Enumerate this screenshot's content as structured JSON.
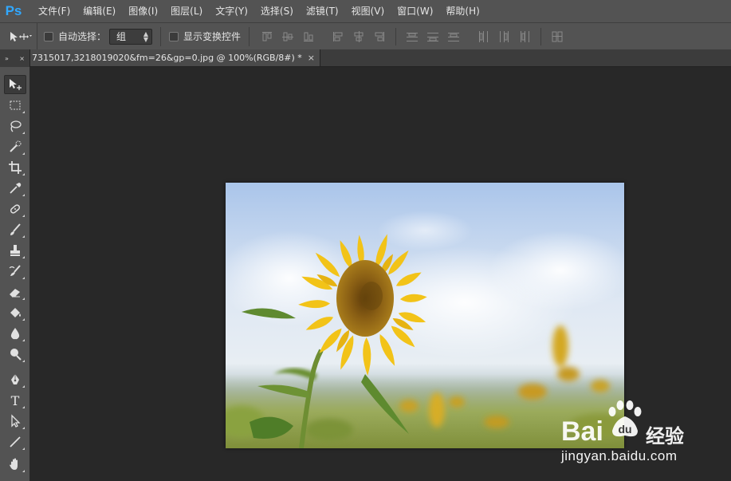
{
  "app": {
    "logo": "Ps"
  },
  "menu": [
    "文件(F)",
    "编辑(E)",
    "图像(I)",
    "图层(L)",
    "文字(Y)",
    "选择(S)",
    "滤镜(T)",
    "视图(V)",
    "窗口(W)",
    "帮助(H)"
  ],
  "options_bar": {
    "auto_select_label": "自动选择：",
    "auto_select_checked": false,
    "auto_select_value": "组",
    "transform_controls_label": "显示变换控件",
    "transform_controls_checked": false
  },
  "document_tab": {
    "title": "7315017,3218019020&fm=26&gp=0.jpg @ 100%(RGB/8#) *",
    "close": "×"
  },
  "panel_collapse": {
    "expand": "»",
    "close": "×"
  },
  "toolbox": {
    "active_tool": "move-tool",
    "tools": [
      "move-tool",
      "marquee-tool",
      "lasso-tool",
      "quick-selection-tool",
      "crop-tool",
      "eyedropper-tool",
      "healing-brush-tool",
      "brush-tool",
      "clone-stamp-tool",
      "history-brush-tool",
      "eraser-tool",
      "paint-bucket-tool",
      "blur-tool",
      "dodge-tool",
      "pen-tool",
      "type-tool",
      "path-selection-tool",
      "line-tool",
      "hand-tool"
    ],
    "type_tool_glyph": "T"
  },
  "canvas": {
    "image_subject": "sunflower photo"
  },
  "watermark": {
    "brand_left": "Bai",
    "brand_right": "经验",
    "url": "jingyan.baidu.com"
  },
  "colors": {
    "ui_panel": "#535353",
    "canvas_bg": "#282828",
    "logo_blue": "#31a8ff",
    "sunflower_petal": "#f2c318",
    "sunflower_center": "#7a5410",
    "sky": "#b9cfe9"
  }
}
